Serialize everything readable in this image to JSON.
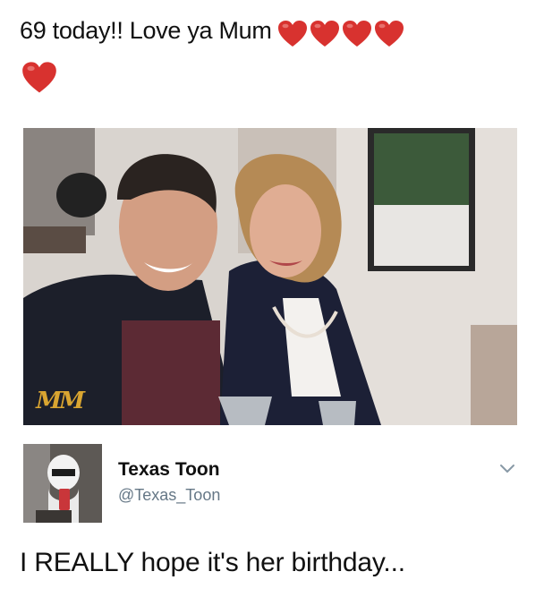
{
  "post": {
    "text": "69 today!! Love ya Mum",
    "hearts_inline": 4,
    "hearts_line2": 1,
    "heart_icon": "red-heart-icon",
    "heart_color": "#d8322f"
  },
  "photo": {
    "overlay_text": "MM",
    "overlay_color": "#d9a531"
  },
  "tweet": {
    "display_name": "Texas Toon",
    "handle": "@Texas_Toon",
    "text": "I REALLY hope it's her birthday...",
    "menu_icon": "chevron-down-icon",
    "handle_color": "#657786"
  }
}
